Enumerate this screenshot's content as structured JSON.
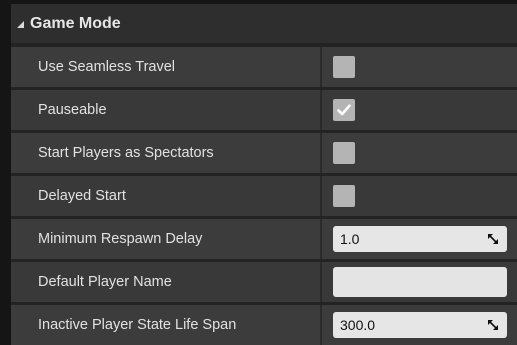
{
  "section": {
    "title": "Game Mode"
  },
  "properties": [
    {
      "label": "Use Seamless Travel",
      "type": "checkbox",
      "checked": false
    },
    {
      "label": "Pauseable",
      "type": "checkbox",
      "checked": true
    },
    {
      "label": "Start Players as Spectators",
      "type": "checkbox",
      "checked": false
    },
    {
      "label": "Delayed Start",
      "type": "checkbox",
      "checked": false
    },
    {
      "label": "Minimum Respawn Delay",
      "type": "number",
      "value": "1.0"
    },
    {
      "label": "Default Player Name",
      "type": "text",
      "value": ""
    },
    {
      "label": "Inactive Player State Life Span",
      "type": "number",
      "value": "300.0"
    }
  ],
  "icons": {
    "collapse": "triangle-collapse-icon",
    "check": "checkmark-icon",
    "drag": "drag-resize-icon"
  }
}
